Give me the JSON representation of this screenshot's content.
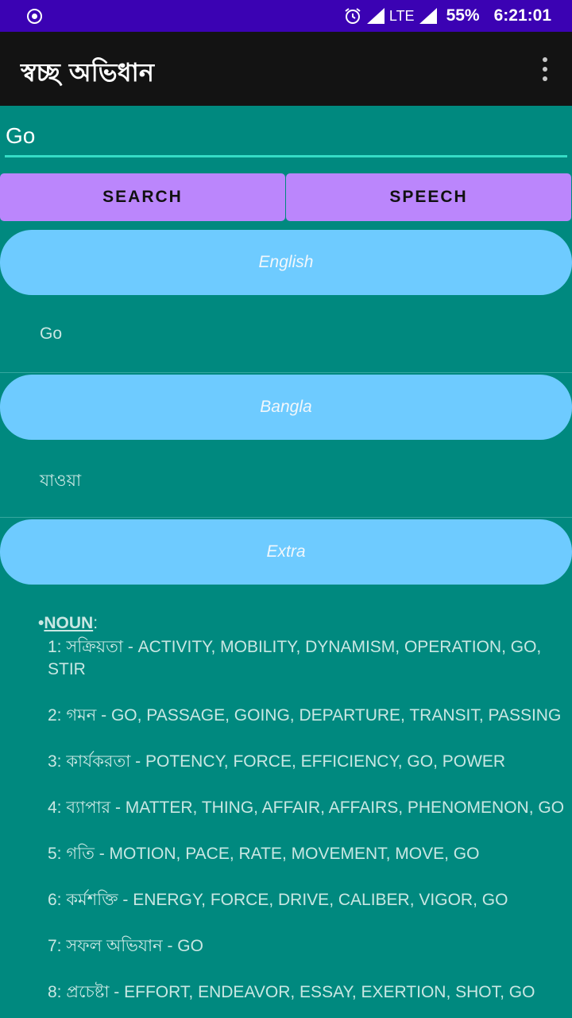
{
  "status_bar": {
    "network": "LTE",
    "battery": "55%",
    "time": "6:21:01",
    "icons": [
      "radio-target-icon",
      "alarm-icon",
      "signal-icon",
      "battery-icon"
    ]
  },
  "app": {
    "title": "স্বচ্ছ অভিধান",
    "overflow_icon": "more-vert-icon"
  },
  "search": {
    "value": "Go"
  },
  "buttons": {
    "search": "SEARCH",
    "speech": "SPEECH"
  },
  "sections": {
    "english": {
      "label": "English",
      "value": "Go"
    },
    "bangla": {
      "label": "Bangla",
      "value": "যাওয়া"
    },
    "extra": {
      "label": "Extra",
      "pos_bullet": "•",
      "pos": "NOUN",
      "pos_suffix": ":",
      "entries": [
        "1: সক্রিয়তা - ACTIVITY, MOBILITY, DYNAMISM, OPERATION, GO, STIR",
        "2: গমন - GO, PASSAGE, GOING, DEPARTURE, TRANSIT, PASSING",
        "3: কার্যকরতা - POTENCY, FORCE, EFFICIENCY, GO, POWER",
        "4: ব্যাপার - MATTER, THING, AFFAIR, AFFAIRS, PHENOMENON, GO",
        "5: গতি - MOTION, PACE, RATE, MOVEMENT, MOVE, GO",
        "6: কর্মশক্তি - ENERGY, FORCE, DRIVE, CALIBER, VIGOR, GO",
        "7: সফল অভিযান - GO",
        "8: প্রচেষ্টা - EFFORT, ENDEAVOR, ESSAY, EXERTION, SHOT, GO"
      ]
    }
  },
  "colors": {
    "status_bar": "#3b02b3",
    "toolbar": "#131313",
    "background": "#00897f",
    "button": "#bb86fc",
    "pill": "#6ecbff",
    "input_underline": "#35dcc6"
  }
}
